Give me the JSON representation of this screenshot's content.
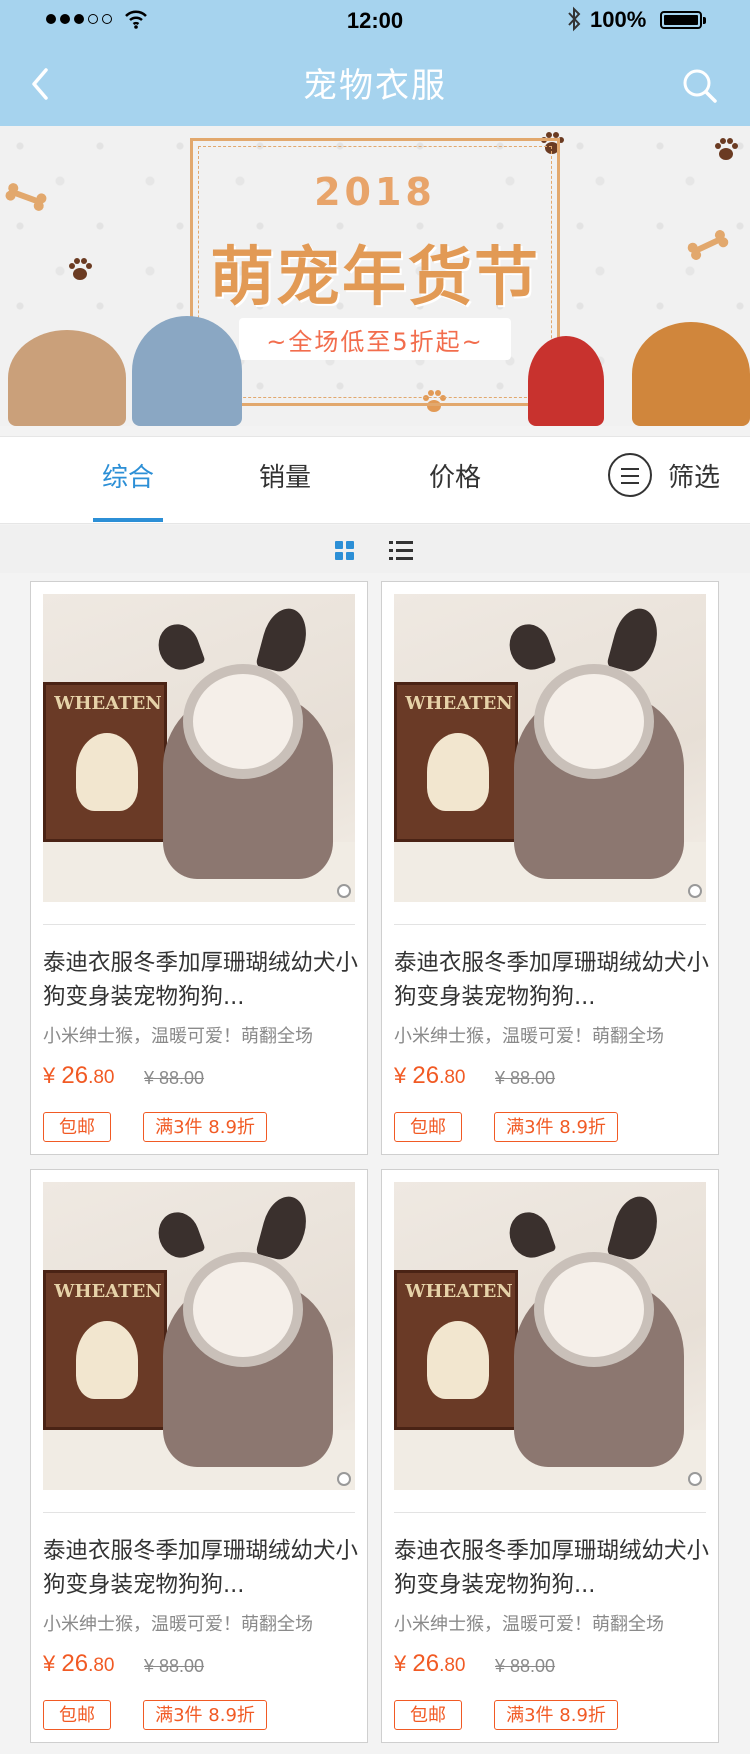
{
  "status_bar": {
    "time": "12:00",
    "battery_text": "100%",
    "battery_level": 1.0,
    "signal_icon": "signal-dots-icon",
    "wifi_icon": "wifi-icon",
    "bluetooth_icon": "bluetooth-icon"
  },
  "nav": {
    "title": "宠物衣服",
    "back_icon": "chevron-left-icon",
    "search_icon": "search-icon"
  },
  "banner": {
    "year": "2018",
    "title": "萌宠年货节",
    "subtitle": "~全场低至5折起~"
  },
  "tabs": [
    {
      "label": "综合",
      "active": true
    },
    {
      "label": "销量",
      "active": false
    },
    {
      "label": "价格",
      "active": false
    },
    {
      "label": "筛选",
      "active": false
    }
  ],
  "view_modes": [
    "grid-icon",
    "list-icon"
  ],
  "products": [
    {
      "title": "泰迪衣服冬季加厚珊瑚绒幼犬小狗变身装宠物狗狗...",
      "desc": "小米绅士猴，温暖可爱！萌翻全场",
      "currency": "¥",
      "price_int": "26",
      "price_dec": ".80",
      "orig_price": "¥ 88.00",
      "tags": [
        "包邮",
        "满3件 8.9折"
      ],
      "image_text": "WHEATEN"
    },
    {
      "title": "泰迪衣服冬季加厚珊瑚绒幼犬小狗变身装宠物狗狗...",
      "desc": "小米绅士猴，温暖可爱！萌翻全场",
      "currency": "¥",
      "price_int": "26",
      "price_dec": ".80",
      "orig_price": "¥ 88.00",
      "tags": [
        "包邮",
        "满3件 8.9折"
      ],
      "image_text": "WHEATEN"
    },
    {
      "title": "泰迪衣服冬季加厚珊瑚绒幼犬小狗变身装宠物狗狗...",
      "desc": "小米绅士猴，温暖可爱！萌翻全场",
      "currency": "¥",
      "price_int": "26",
      "price_dec": ".80",
      "orig_price": "¥ 88.00",
      "tags": [
        "包邮",
        "满3件 8.9折"
      ],
      "image_text": "WHEATEN"
    },
    {
      "title": "泰迪衣服冬季加厚珊瑚绒幼犬小狗变身装宠物狗狗...",
      "desc": "小米绅士猴，温暖可爱！萌翻全场",
      "currency": "¥",
      "price_int": "26",
      "price_dec": ".80",
      "orig_price": "¥ 88.00",
      "tags": [
        "包邮",
        "满3件 8.9折"
      ],
      "image_text": "WHEATEN"
    }
  ],
  "colors": {
    "header_bg": "#a6d3ee",
    "accent_blue": "#2c8fd6",
    "price_orange": "#f15a24",
    "banner_gold": "#e29a55"
  }
}
